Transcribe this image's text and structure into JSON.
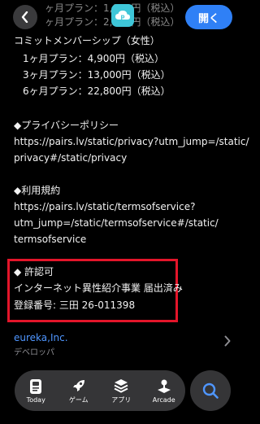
{
  "header": {
    "open_label": "開く",
    "faded_line1": "ヶ月プラン：1,800円（税込）",
    "faded_line2": "ヶ月プラン：2,800円（税込）"
  },
  "membership": {
    "title": "コミットメンバーシップ（女性）",
    "plans": [
      "1ヶ月プラン：4,900円（税込）",
      "3ヶ月プラン：13,000円（税込）",
      "6ヶ月プラン：22,800円（税込）"
    ]
  },
  "privacy": {
    "heading": "◆プライバシーポリシー",
    "url_line1": "https://pairs.lv/static/privacy?utm_jump=/static/",
    "url_line2": "privacy#/static/privacy"
  },
  "terms": {
    "heading": "◆利用規約",
    "url_line1": "https://pairs.lv/static/termsofservice?",
    "url_line2": "utm_jump=/static/termsofservice#/static/",
    "url_line3": "termsofservice"
  },
  "license": {
    "heading": "◆ 許認可",
    "line1": "インターネット異性紹介事業 届出済み",
    "line2": "登録番号: 三田 26-011398"
  },
  "developer": {
    "name": "eureka,Inc.",
    "label": "デベロッパ"
  },
  "tabbar": {
    "tabs": [
      {
        "label": "Today",
        "icon": "today-icon"
      },
      {
        "label": "ゲーム",
        "icon": "rocket-icon"
      },
      {
        "label": "アプリ",
        "icon": "apps-stack-icon"
      },
      {
        "label": "Arcade",
        "icon": "arcade-joystick-icon"
      }
    ],
    "search_icon": "search-icon"
  },
  "colors": {
    "accent": "#2f80f6",
    "link": "#4f96ff",
    "highlight": "#e3152a",
    "app_icon": "#3ec6d8"
  }
}
